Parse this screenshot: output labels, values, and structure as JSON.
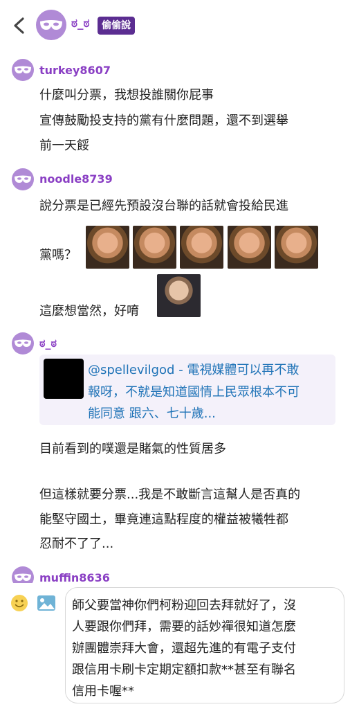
{
  "header": {
    "title": "ಠ_ಠ",
    "badge": "偷偷說",
    "back_icon": "chevron-left-icon",
    "avatar_icon": "mask-icon"
  },
  "posts": [
    {
      "user": "turkey8607",
      "lines": [
        "什麼叫分票，我想投誰關你屁事",
        "宣傳鼓勵投支持的黨有什麼問題，還不到選舉",
        "前一天餒"
      ]
    },
    {
      "user": "noodle8739",
      "lines": [
        "說分票是已經先預設沒台聯的話就會投給民進",
        "黨嗎？",
        "這麼想當然，好唷"
      ]
    },
    {
      "user": "ಠ_ಠ",
      "quote": {
        "lines": [
          "@spellevilgod - 電視媒體可以再不敢",
          "報呀，不就是知道國情上民眾根本不可",
          "能同意 跟六、七十歲..."
        ]
      },
      "lines": [
        "目前看到的噗還是賭氣的性質居多",
        "但這樣就要分票...我是不敢斷言這幫人是否真的",
        "能堅守國土，畢竟連這點程度的權益被犧牲都",
        "忍耐不了了..."
      ]
    },
    {
      "user": "muffin8636"
    }
  ],
  "composer": {
    "emoji_icon": "smiley-icon",
    "image_icon": "image-icon",
    "lines": [
      "師父要當神你們柯粉迎回去拜就好了，沒",
      "人要跟你們拜，需要的話妙禪很知道怎麼",
      "辦團體崇拜大會，還超先進的有電子支付",
      "跟信用卡刷卡定期定額扣款**甚至有聯名",
      "信用卡喔**"
    ]
  }
}
